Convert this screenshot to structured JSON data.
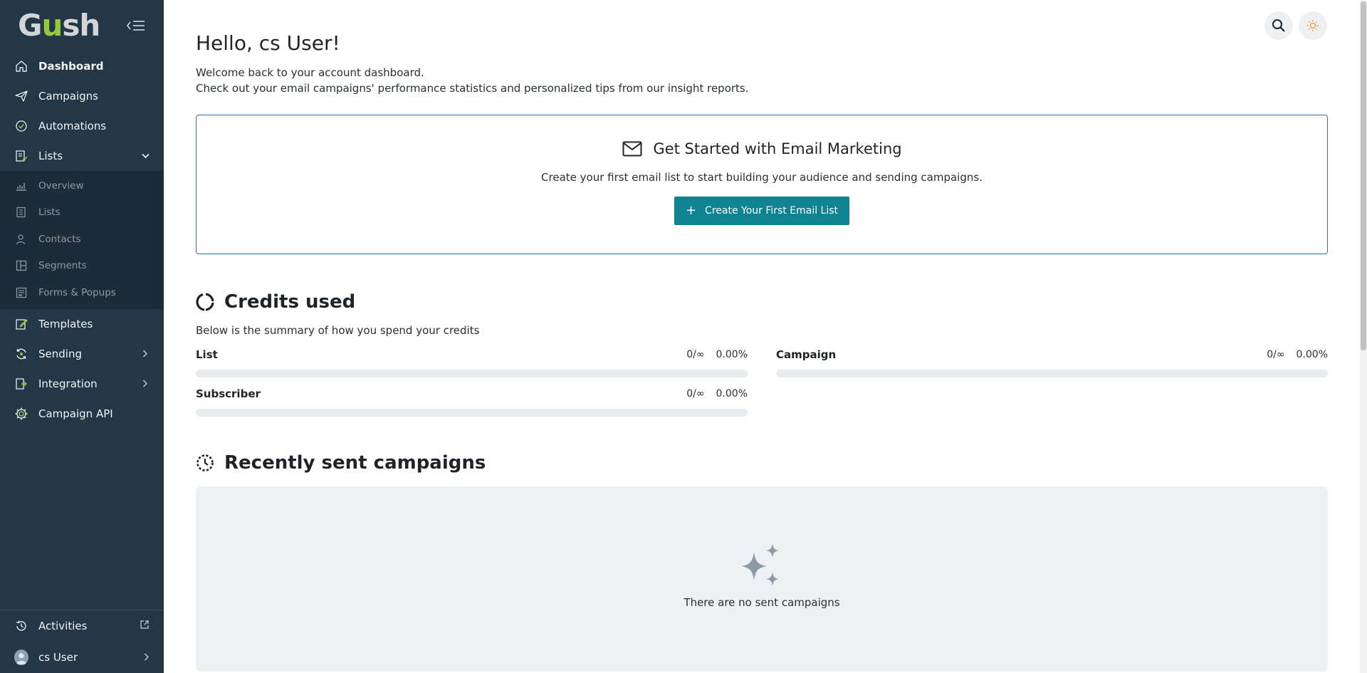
{
  "colors": {
    "sidebar_bg": "#243747",
    "submenu_bg": "#1d2c37",
    "accent": "#0e8391",
    "logo_green": "#94c93d",
    "card_border": "#2f72b3"
  },
  "logo": {
    "pre": "G",
    "u": "u",
    "post": "sh"
  },
  "sidebar": {
    "collapse_icon": "collapse-menu-icon",
    "items": [
      {
        "label": "Dashboard",
        "icon": "home-icon",
        "active": true
      },
      {
        "label": "Campaigns",
        "icon": "paper-plane-icon"
      },
      {
        "label": "Automations",
        "icon": "shield-check-icon"
      },
      {
        "label": "Lists",
        "icon": "list-icon",
        "expanded": true
      }
    ],
    "sub_items": [
      {
        "label": "Overview",
        "icon": "chart-icon"
      },
      {
        "label": "Lists",
        "icon": "list-icon"
      },
      {
        "label": "Contacts",
        "icon": "contacts-icon"
      },
      {
        "label": "Segments",
        "icon": "segments-icon"
      },
      {
        "label": "Forms & Popups",
        "icon": "form-icon"
      }
    ],
    "items_after": [
      {
        "label": "Templates",
        "icon": "edit-icon"
      },
      {
        "label": "Sending",
        "icon": "sync-icon"
      },
      {
        "label": "Integration",
        "icon": "integration-icon"
      },
      {
        "label": "Campaign API",
        "icon": "gear-icon"
      }
    ],
    "bottom": [
      {
        "label": "Activities",
        "icon": "history-icon",
        "trailing_icon": "external-link-icon"
      },
      {
        "label": "cs User",
        "icon": "avatar-icon",
        "trailing_icon": "chevron-right-icon"
      }
    ]
  },
  "header": {
    "search_icon": "search-icon",
    "theme_icon": "sun-icon"
  },
  "main": {
    "greeting": "Hello, cs User!",
    "welcome_line1": "Welcome back to your account dashboard.",
    "welcome_line2": "Check out your email campaigns' performance statistics and personalized tips from our insight reports.",
    "get_started": {
      "title": "Get Started with Email Marketing",
      "description": "Create your first email list to start building your audience and sending campaigns.",
      "button": "Create Your First Email List",
      "button_plus": "+"
    },
    "credits": {
      "title": "Credits used",
      "description": "Below is the summary of how you spend your credits",
      "items": [
        {
          "name": "List",
          "usage": "0/∞",
          "percent": "0.00%",
          "fill": 0
        },
        {
          "name": "Campaign",
          "usage": "0/∞",
          "percent": "0.00%",
          "fill": 0
        },
        {
          "name": "Subscriber",
          "usage": "0/∞",
          "percent": "0.00%",
          "fill": 0
        }
      ]
    },
    "recent": {
      "title": "Recently sent campaigns",
      "empty_text": "There are no sent campaigns"
    }
  }
}
